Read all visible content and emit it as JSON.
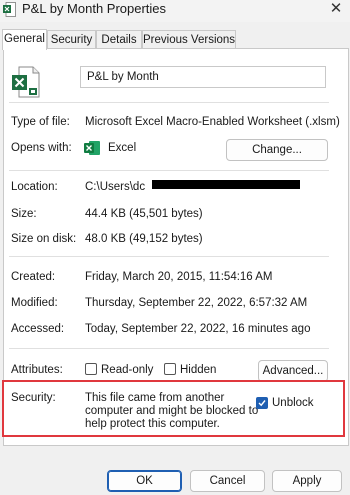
{
  "window": {
    "title": "P&L by Month Properties",
    "close_glyph": "✕",
    "accent": "#1f5fb2",
    "excel_green": "#1d6f42",
    "highlight_color": "#e0383e"
  },
  "tabs": [
    "General",
    "Security",
    "Details",
    "Previous Versions"
  ],
  "general": {
    "file_name": "P&L by Month",
    "type_label": "Type of file:",
    "type_value": "Microsoft Excel Macro-Enabled Worksheet (.xlsm)",
    "opens_label": "Opens with:",
    "opens_value": "Excel",
    "change_button": "Change...",
    "location_label": "Location:",
    "location_value": "C:\\Users\\dc",
    "size_label": "Size:",
    "size_value": "44.4 KB (45,501 bytes)",
    "size_disk_label": "Size on disk:",
    "size_disk_value": "48.0 KB (49,152 bytes)",
    "created_label": "Created:",
    "created_value": "Friday, March 20, 2015, 11:54:16 AM",
    "modified_label": "Modified:",
    "modified_value": "Thursday, September 22, 2022, 6:57:32 AM",
    "accessed_label": "Accessed:",
    "accessed_value": "Today, September 22, 2022, 16 minutes ago",
    "attributes_label": "Attributes:",
    "readonly_label": "Read-only",
    "hidden_label": "Hidden",
    "advanced_button": "Advanced...",
    "security_label": "Security:",
    "security_line1": "This file came from another",
    "security_line2": "computer and might be blocked to",
    "security_line3": "help protect this computer.",
    "unblock_label": "Unblock",
    "unblock_checked": true,
    "readonly_checked": false,
    "hidden_checked": false
  },
  "footer": {
    "ok": "OK",
    "cancel": "Cancel",
    "apply": "Apply"
  }
}
